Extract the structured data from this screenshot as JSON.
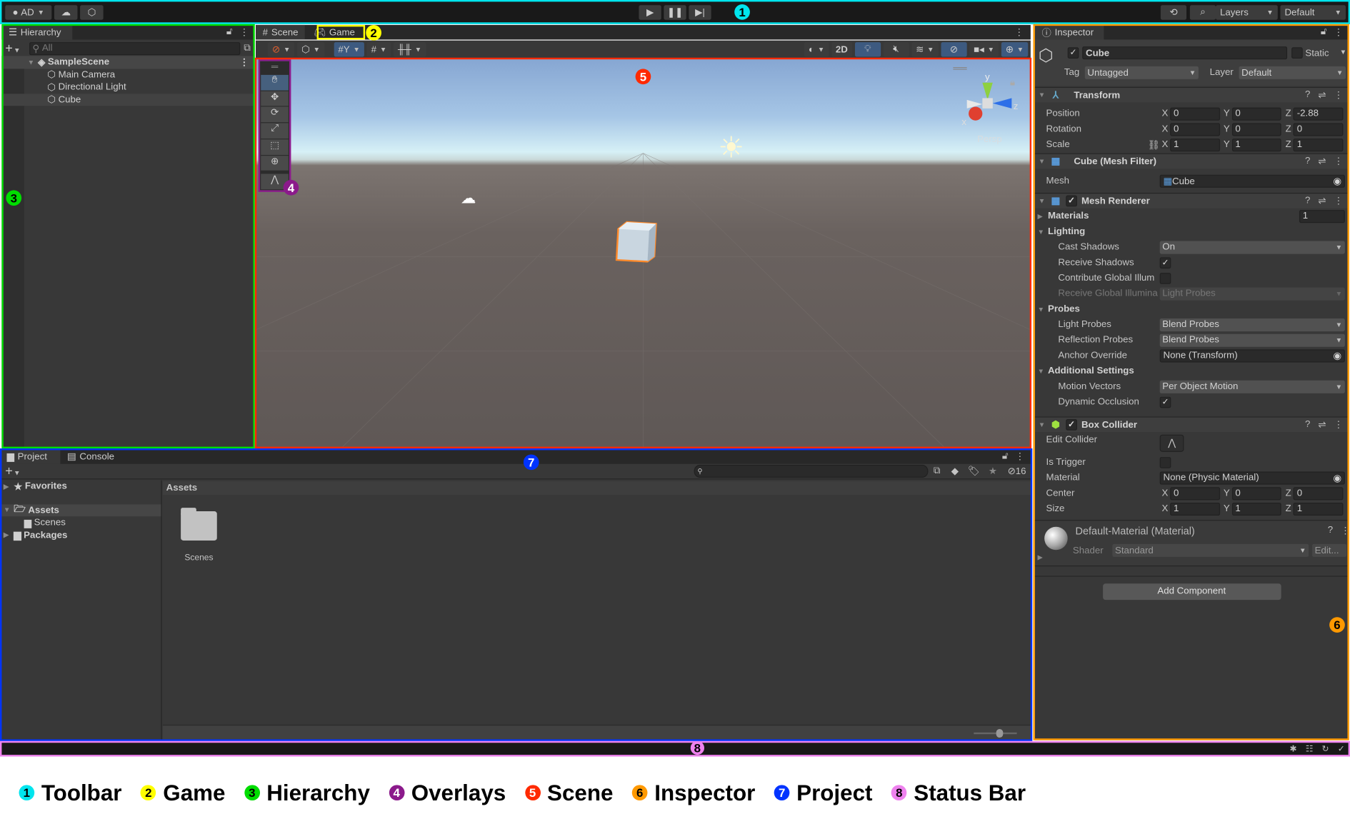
{
  "toolbar": {
    "account": "AD",
    "layers": "Layers",
    "layout": "Default",
    "icons": [
      "account-icon",
      "cloud-icon",
      "collab-icon",
      "play-icon",
      "pause-icon",
      "step-icon",
      "history-icon",
      "search-icon"
    ]
  },
  "hierarchy": {
    "tab": "Hierarchy",
    "search_placeholder": "All",
    "scene": "SampleScene",
    "items": [
      "Main Camera",
      "Directional Light",
      "Cube"
    ]
  },
  "scene_tabs": {
    "scene": "Scene",
    "game": "Game"
  },
  "scene_toolbar": {
    "mode_2d": "2D"
  },
  "scene_view": {
    "persp": "Persp",
    "axes": {
      "x": "x",
      "y": "y",
      "z": "z"
    }
  },
  "inspector": {
    "tab": "Inspector",
    "object_name": "Cube",
    "static_label": "Static",
    "tag_label": "Tag",
    "tag": "Untagged",
    "layer_label": "Layer",
    "layer": "Default",
    "transform": {
      "title": "Transform",
      "position_label": "Position",
      "rotation_label": "Rotation",
      "scale_label": "Scale",
      "position": [
        "0",
        "0",
        "-2.88"
      ],
      "rotation": [
        "0",
        "0",
        "0"
      ],
      "scale": [
        "1",
        "1",
        "1"
      ]
    },
    "mesh_filter": {
      "title": "Cube (Mesh Filter)",
      "mesh_label": "Mesh",
      "mesh": "Cube"
    },
    "mesh_renderer": {
      "title": "Mesh Renderer",
      "materials_label": "Materials",
      "materials_count": "1",
      "lighting": "Lighting",
      "cast_shadows_label": "Cast Shadows",
      "cast_shadows": "On",
      "receive_shadows_label": "Receive Shadows",
      "contribute_gi_label": "Contribute Global Illum",
      "receive_gi_label": "Receive Global Illumina",
      "receive_gi": "Light Probes",
      "probes": "Probes",
      "light_probes_label": "Light Probes",
      "light_probes": "Blend Probes",
      "reflection_probes_label": "Reflection Probes",
      "reflection_probes": "Blend Probes",
      "anchor_label": "Anchor Override",
      "anchor": "None (Transform)",
      "additional": "Additional Settings",
      "motion_vectors_label": "Motion Vectors",
      "motion_vectors": "Per Object Motion",
      "dynamic_occlusion_label": "Dynamic Occlusion"
    },
    "box_collider": {
      "title": "Box Collider",
      "edit_label": "Edit Collider",
      "trigger_label": "Is Trigger",
      "material_label": "Material",
      "material": "None (Physic Material)",
      "center_label": "Center",
      "size_label": "Size",
      "center": [
        "0",
        "0",
        "0"
      ],
      "size": [
        "1",
        "1",
        "1"
      ]
    },
    "material": {
      "title": "Default-Material (Material)",
      "shader_label": "Shader",
      "shader": "Standard",
      "edit": "Edit..."
    },
    "add_component": "Add Component"
  },
  "project": {
    "tabs": [
      "Project",
      "Console"
    ],
    "hidden_count": "16",
    "favorites": "Favorites",
    "assets": "Assets",
    "scenes": "Scenes",
    "packages": "Packages",
    "header": "Assets",
    "folder": "Scenes"
  },
  "annotations": {
    "colors": {
      "toolbar": "#00e5ee",
      "game": "#ffff00",
      "hierarchy": "#00dd00",
      "overlays": "#8b1a8b",
      "scene": "#ff2a00",
      "inspector": "#ff9900",
      "project": "#0033ff",
      "status": "#ee82ee"
    },
    "legend": [
      {
        "n": "1",
        "label": "Toolbar"
      },
      {
        "n": "2",
        "label": "Game"
      },
      {
        "n": "3",
        "label": "Hierarchy"
      },
      {
        "n": "4",
        "label": "Overlays"
      },
      {
        "n": "5",
        "label": "Scene"
      },
      {
        "n": "6",
        "label": "Inspector"
      },
      {
        "n": "7",
        "label": "Project"
      },
      {
        "n": "8",
        "label": "Status Bar"
      }
    ]
  }
}
